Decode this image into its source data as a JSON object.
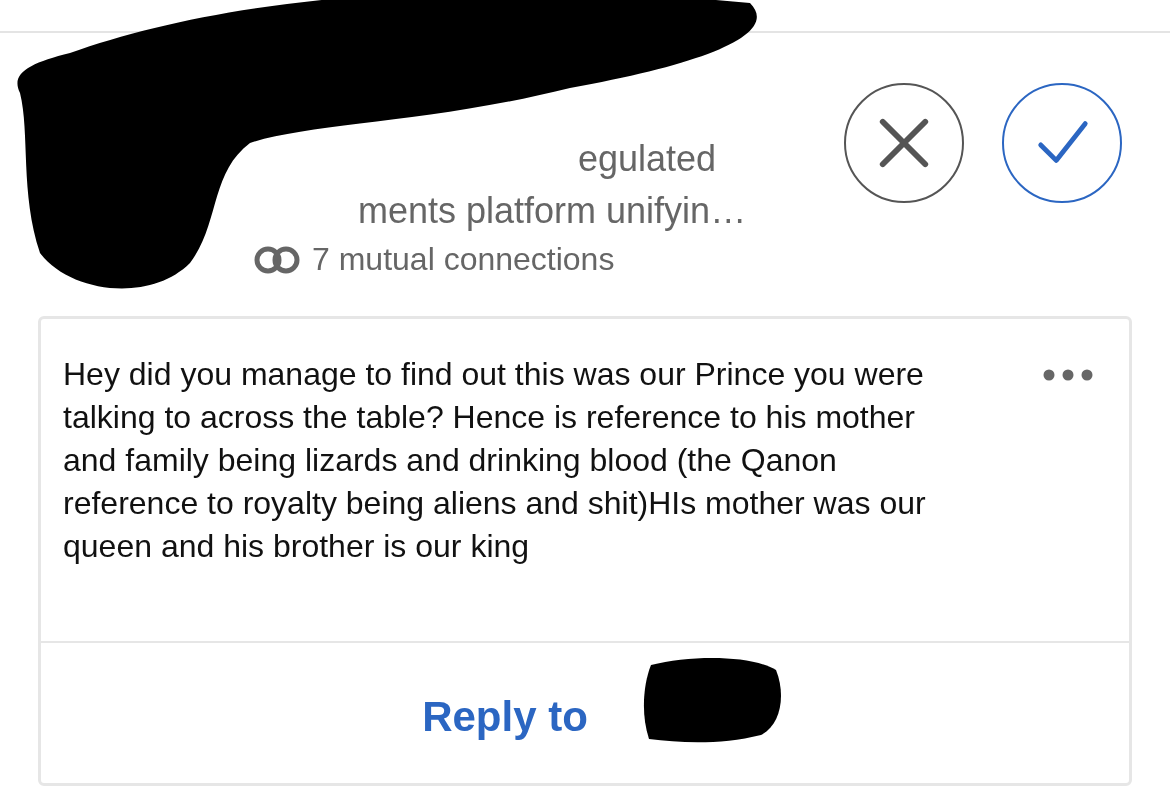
{
  "profile": {
    "headline_lines": [
      "egulated",
      "ments platform unifyin…"
    ],
    "mutual_connections": "7 mutual connections"
  },
  "actions": [
    {
      "kind": "ignore"
    },
    {
      "kind": "accept"
    }
  ],
  "message": {
    "text": "Hey did you manage to find out this was our Prince you were talking to across the table? Hence is reference to his mother and family being lizards and drinking blood (the Qanon reference to royalty being aliens and shit)HIs mother was our queen and his brother is our king",
    "reply_label": "Reply to"
  }
}
